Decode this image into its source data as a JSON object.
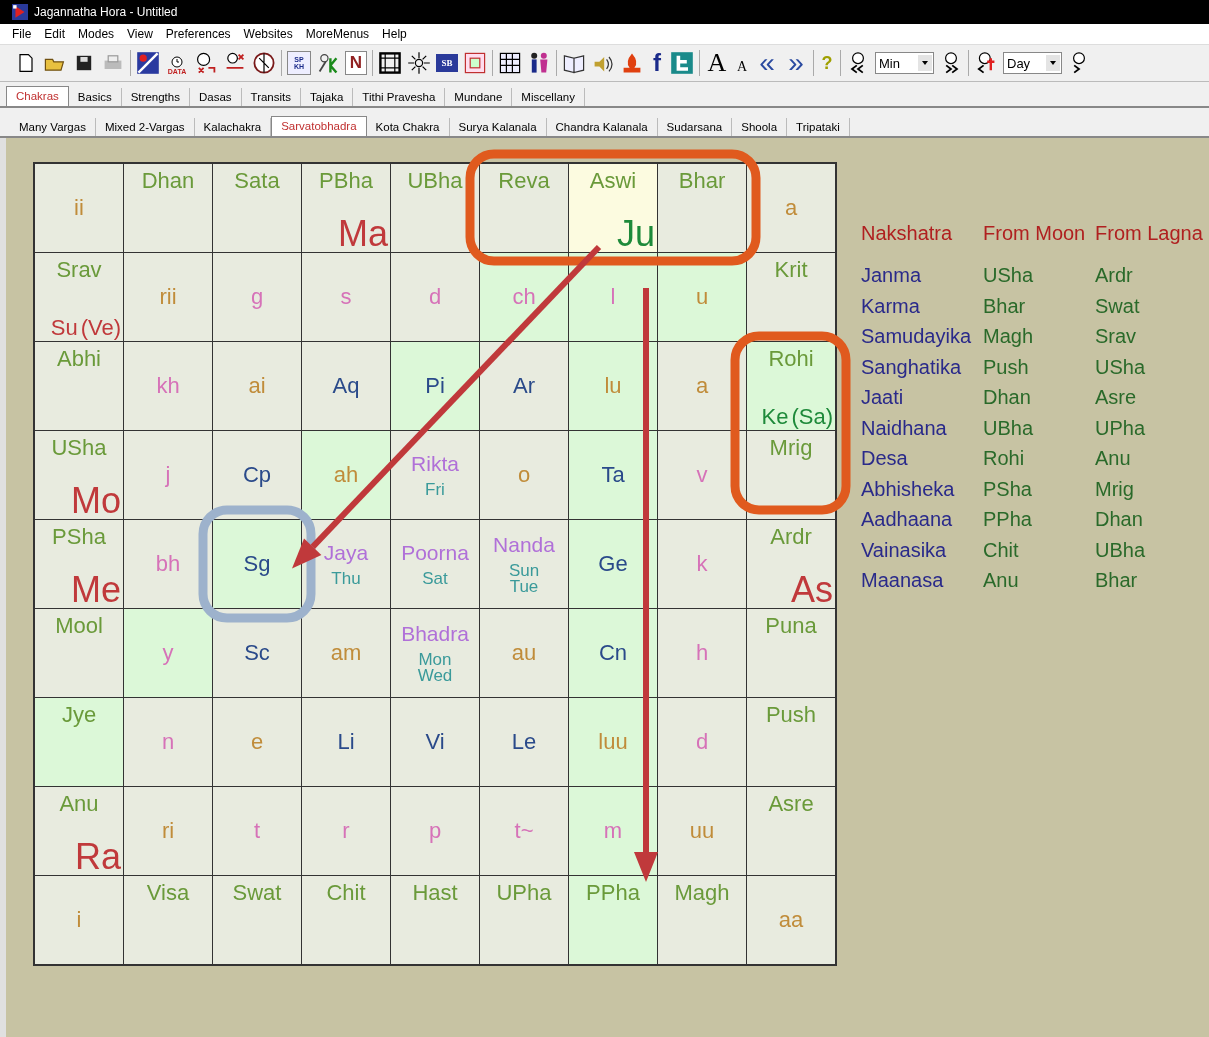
{
  "window": {
    "title": "Jagannatha Hora - Untitled"
  },
  "menu": [
    "File",
    "Edit",
    "Modes",
    "View",
    "Preferences",
    "Websites",
    "MoreMenus",
    "Help"
  ],
  "toolbar": {
    "glyphs": [
      "DATA",
      "SP",
      "KH",
      "N",
      "SB",
      "f",
      "A",
      "A",
      "«",
      "»",
      "?"
    ],
    "dropdowns": [
      {
        "value": "Min"
      },
      {
        "value": "Day"
      }
    ]
  },
  "tabs": [
    {
      "label": "Chakras",
      "selected": true
    },
    {
      "label": "Basics",
      "selected": false
    },
    {
      "label": "Strengths",
      "selected": false
    },
    {
      "label": "Dasas",
      "selected": false
    },
    {
      "label": "Transits",
      "selected": false
    },
    {
      "label": "Tajaka",
      "selected": false
    },
    {
      "label": "Tithi Pravesha",
      "selected": false
    },
    {
      "label": "Mundane",
      "selected": false
    },
    {
      "label": "Miscellany",
      "selected": false
    }
  ],
  "subtabs": [
    {
      "label": "Many Vargas",
      "selected": false
    },
    {
      "label": "Mixed 2-Vargas",
      "selected": false
    },
    {
      "label": "Kalachakra",
      "selected": false
    },
    {
      "label": "Sarvatobhadra",
      "selected": true
    },
    {
      "label": "Kota Chakra",
      "selected": false
    },
    {
      "label": "Surya Kalanala",
      "selected": false
    },
    {
      "label": "Chandra Kalanala",
      "selected": false
    },
    {
      "label": "Sudarsana",
      "selected": false
    },
    {
      "label": "Shoola",
      "selected": false
    },
    {
      "label": "Tripataki",
      "selected": false
    }
  ],
  "chakra": {
    "rows": [
      [
        {
          "text": "ii",
          "kind": "vowel"
        },
        {
          "text": "Dhan",
          "kind": "nakshatra"
        },
        {
          "text": "Sata",
          "kind": "nakshatra"
        },
        {
          "text": "PBha",
          "kind": "nakshatra",
          "planets": [
            {
              "label": "Ma",
              "color": "#c0393b"
            }
          ]
        },
        {
          "text": "UBha",
          "kind": "nakshatra"
        },
        {
          "text": "Reva",
          "kind": "nakshatra"
        },
        {
          "text": "Aswi",
          "kind": "nakshatra",
          "color": "#fcfbe0",
          "planets": [
            {
              "label": "Ju",
              "color": "#1e8a3a"
            }
          ]
        },
        {
          "text": "Bhar",
          "kind": "nakshatra"
        },
        {
          "text": "a",
          "kind": "vowel"
        }
      ],
      [
        {
          "text": "Srav",
          "kind": "nakshatra",
          "planets": [
            {
              "label": "Su",
              "color": "#c0393b"
            },
            {
              "label": "(Ve)",
              "color": "#c0393b"
            }
          ]
        },
        {
          "text": "rii",
          "kind": "vowel"
        },
        {
          "text": "g",
          "kind": "consonant"
        },
        {
          "text": "s",
          "kind": "consonant"
        },
        {
          "text": "d",
          "kind": "consonant"
        },
        {
          "text": "ch",
          "kind": "consonant",
          "color": "#dcf8d8"
        },
        {
          "text": "l",
          "kind": "consonant",
          "color": "#dcf8d8"
        },
        {
          "text": "u",
          "kind": "vowel",
          "color": "#dcf8d8"
        },
        {
          "text": "Krit",
          "kind": "nakshatra"
        }
      ],
      [
        {
          "text": "Abhi",
          "kind": "nakshatra"
        },
        {
          "text": "kh",
          "kind": "consonant"
        },
        {
          "text": "ai",
          "kind": "vowel"
        },
        {
          "text": "Aq",
          "kind": "sign"
        },
        {
          "text": "Pi",
          "kind": "sign",
          "color": "#dcf8d8"
        },
        {
          "text": "Ar",
          "kind": "sign"
        },
        {
          "text": "lu",
          "kind": "vowel",
          "color": "#dcf8d8"
        },
        {
          "text": "a",
          "kind": "vowel"
        },
        {
          "text": "Rohi",
          "kind": "nakshatra",
          "color": "#dcf8d8",
          "planets": [
            {
              "label": "Ke",
              "color": "#1e8a3a"
            },
            {
              "label": "(Sa)",
              "color": "#1e8a3a"
            }
          ]
        }
      ],
      [
        {
          "text": "USha",
          "kind": "nakshatra",
          "planets": [
            {
              "label": "Mo",
              "color": "#c0393b"
            }
          ]
        },
        {
          "text": "j",
          "kind": "consonant"
        },
        {
          "text": "Cp",
          "kind": "sign"
        },
        {
          "text": "ah",
          "kind": "vowel",
          "color": "#dcf8d8"
        },
        {
          "text": "Rikta",
          "kind": "tithi",
          "days": [
            "Fri"
          ]
        },
        {
          "text": "o",
          "kind": "vowel"
        },
        {
          "text": "Ta",
          "kind": "sign",
          "color": "#dcf8d8"
        },
        {
          "text": "v",
          "kind": "consonant"
        },
        {
          "text": "Mrig",
          "kind": "nakshatra"
        }
      ],
      [
        {
          "text": "PSha",
          "kind": "nakshatra",
          "planets": [
            {
              "label": "Me",
              "color": "#c0393b"
            }
          ]
        },
        {
          "text": "bh",
          "kind": "consonant"
        },
        {
          "text": "Sg",
          "kind": "sign",
          "color": "#dcf8d8"
        },
        {
          "text": "Jaya",
          "kind": "tithi",
          "days": [
            "Thu"
          ]
        },
        {
          "text": "Poorna",
          "kind": "tithi",
          "days": [
            "Sat"
          ]
        },
        {
          "text": "Nanda",
          "kind": "tithi",
          "days": [
            "Sun",
            "Tue"
          ]
        },
        {
          "text": "Ge",
          "kind": "sign",
          "color": "#dcf8d8"
        },
        {
          "text": "k",
          "kind": "consonant"
        },
        {
          "text": "Ardr",
          "kind": "nakshatra",
          "planets": [
            {
              "label": "As",
              "color": "#c0393b"
            }
          ]
        }
      ],
      [
        {
          "text": "Mool",
          "kind": "nakshatra"
        },
        {
          "text": "y",
          "kind": "consonant",
          "color": "#dcf8d8"
        },
        {
          "text": "Sc",
          "kind": "sign"
        },
        {
          "text": "am",
          "kind": "vowel"
        },
        {
          "text": "Bhadra",
          "kind": "tithi",
          "days": [
            "Mon",
            "Wed"
          ]
        },
        {
          "text": "au",
          "kind": "vowel"
        },
        {
          "text": "Cn",
          "kind": "sign",
          "color": "#dcf8d8"
        },
        {
          "text": "h",
          "kind": "consonant"
        },
        {
          "text": "Puna",
          "kind": "nakshatra"
        }
      ],
      [
        {
          "text": "Jye",
          "kind": "nakshatra",
          "color": "#dcf8d8"
        },
        {
          "text": "n",
          "kind": "consonant"
        },
        {
          "text": "e",
          "kind": "vowel"
        },
        {
          "text": "Li",
          "kind": "sign"
        },
        {
          "text": "Vi",
          "kind": "sign"
        },
        {
          "text": "Le",
          "kind": "sign"
        },
        {
          "text": "luu",
          "kind": "vowel",
          "color": "#dcf8d8"
        },
        {
          "text": "d",
          "kind": "consonant"
        },
        {
          "text": "Push",
          "kind": "nakshatra"
        }
      ],
      [
        {
          "text": "Anu",
          "kind": "nakshatra",
          "planets": [
            {
              "label": "Ra",
              "color": "#c0393b"
            }
          ]
        },
        {
          "text": "ri",
          "kind": "vowel"
        },
        {
          "text": "t",
          "kind": "consonant"
        },
        {
          "text": "r",
          "kind": "consonant"
        },
        {
          "text": "p",
          "kind": "consonant"
        },
        {
          "text": "t~",
          "kind": "consonant"
        },
        {
          "text": "m",
          "kind": "consonant",
          "color": "#dcf8d8"
        },
        {
          "text": "uu",
          "kind": "vowel"
        },
        {
          "text": "Asre",
          "kind": "nakshatra"
        }
      ],
      [
        {
          "text": "i",
          "kind": "vowel"
        },
        {
          "text": "Visa",
          "kind": "nakshatra"
        },
        {
          "text": "Swat",
          "kind": "nakshatra"
        },
        {
          "text": "Chit",
          "kind": "nakshatra"
        },
        {
          "text": "Hast",
          "kind": "nakshatra"
        },
        {
          "text": "UPha",
          "kind": "nakshatra"
        },
        {
          "text": "PPha",
          "kind": "nakshatra",
          "color": "#dcf8d8"
        },
        {
          "text": "Magh",
          "kind": "nakshatra"
        },
        {
          "text": "aa",
          "kind": "vowel"
        }
      ]
    ],
    "annotations": [
      {
        "kind": "box",
        "color": "#e05a1e"
      },
      {
        "kind": "box",
        "color": "#e05a1e"
      },
      {
        "kind": "box",
        "color": "#9db2cc"
      },
      {
        "kind": "arrow",
        "color": "#c0393b"
      },
      {
        "kind": "arrow",
        "color": "#c0393b"
      }
    ]
  },
  "nakshatra_table": {
    "columns": [
      "Nakshatra",
      "From Moon",
      "From Lagna"
    ],
    "rows": [
      [
        "Janma",
        "USha",
        "Ardr"
      ],
      [
        "Karma",
        "Bhar",
        "Swat"
      ],
      [
        "Samudayika",
        "Magh",
        "Srav"
      ],
      [
        "Sanghatika",
        "Push",
        "USha"
      ],
      [
        "Jaati",
        "Dhan",
        "Asre"
      ],
      [
        "Naidhana",
        "UBha",
        "UPha"
      ],
      [
        "Desa",
        "Rohi",
        "Anu"
      ],
      [
        "Abhisheka",
        "PSha",
        "Mrig"
      ],
      [
        "Aadhaana",
        "PPha",
        "Dhan"
      ],
      [
        "Vainasika",
        "Chit",
        "UBha"
      ],
      [
        "Maanasa",
        "Anu",
        "Bhar"
      ]
    ]
  }
}
